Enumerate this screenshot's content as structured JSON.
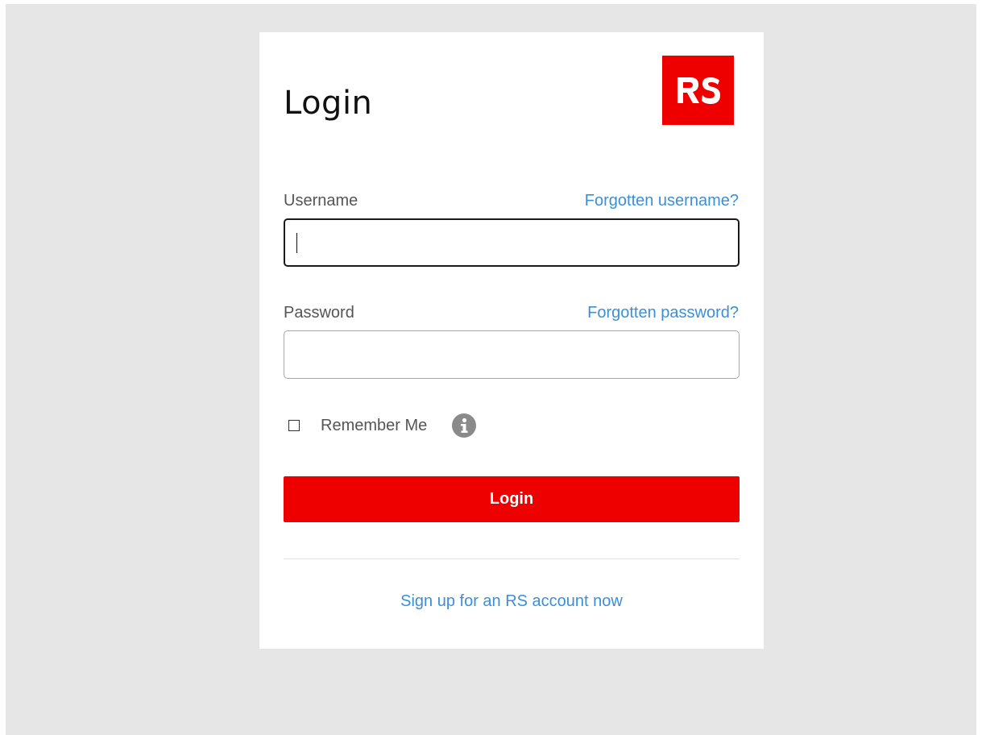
{
  "login_form": {
    "title": "Login",
    "logo_text": "RS",
    "username": {
      "label": "Username",
      "forgot_link": "Forgotten username?",
      "value": "",
      "placeholder": ""
    },
    "password": {
      "label": "Password",
      "forgot_link": "Forgotten password?",
      "value": "",
      "placeholder": ""
    },
    "remember_me": {
      "label": "Remember Me",
      "checked": false,
      "info_icon": "info-circle-icon"
    },
    "submit_label": "Login",
    "signup_link": "Sign up for an RS account now"
  },
  "colors": {
    "brand_red": "#ee0000",
    "link_blue": "#3b8fd9",
    "backdrop_gray": "#e6e6e6",
    "label_gray": "#555555"
  }
}
